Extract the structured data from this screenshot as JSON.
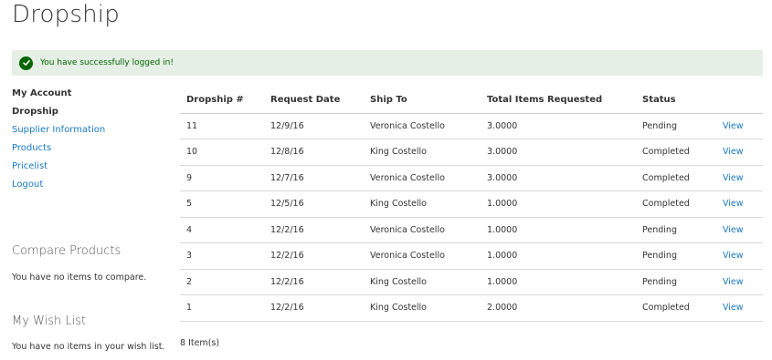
{
  "page": {
    "title": "Dropship"
  },
  "message": {
    "text": "You have successfully logged in!"
  },
  "sidebar": {
    "title": "My Account",
    "current": "Dropship",
    "links": [
      "Supplier Information",
      "Products",
      "Pricelist",
      "Logout"
    ]
  },
  "compare": {
    "title": "Compare Products",
    "empty_text": "You have no items to compare."
  },
  "wishlist": {
    "title": "My Wish List",
    "empty_text": "You have no items in your wish list."
  },
  "table": {
    "headers": [
      "Dropship #",
      "Request Date",
      "Ship To",
      "Total Items Requested",
      "Status",
      ""
    ],
    "rows": [
      {
        "id": "11",
        "date": "12/9/16",
        "ship_to": "Veronica Costello",
        "total": "3.0000",
        "status": "Pending",
        "action": "View"
      },
      {
        "id": "10",
        "date": "12/8/16",
        "ship_to": "King Costello",
        "total": "3.0000",
        "status": "Completed",
        "action": "View"
      },
      {
        "id": "9",
        "date": "12/7/16",
        "ship_to": "Veronica Costello",
        "total": "3.0000",
        "status": "Completed",
        "action": "View"
      },
      {
        "id": "5",
        "date": "12/5/16",
        "ship_to": "King Costello",
        "total": "1.0000",
        "status": "Completed",
        "action": "View"
      },
      {
        "id": "4",
        "date": "12/2/16",
        "ship_to": "Veronica Costello",
        "total": "1.0000",
        "status": "Pending",
        "action": "View"
      },
      {
        "id": "3",
        "date": "12/2/16",
        "ship_to": "Veronica Costello",
        "total": "1.0000",
        "status": "Pending",
        "action": "View"
      },
      {
        "id": "2",
        "date": "12/2/16",
        "ship_to": "King Costello",
        "total": "1.0000",
        "status": "Pending",
        "action": "View"
      },
      {
        "id": "1",
        "date": "12/2/16",
        "ship_to": "King Costello",
        "total": "2.0000",
        "status": "Completed",
        "action": "View"
      }
    ],
    "item_count": "8 Item(s)"
  },
  "colors": {
    "link": "#1979c3",
    "success_bg": "#e5efe5",
    "success_text": "#006400"
  },
  "icons": {
    "message": "check-circle-icon"
  }
}
